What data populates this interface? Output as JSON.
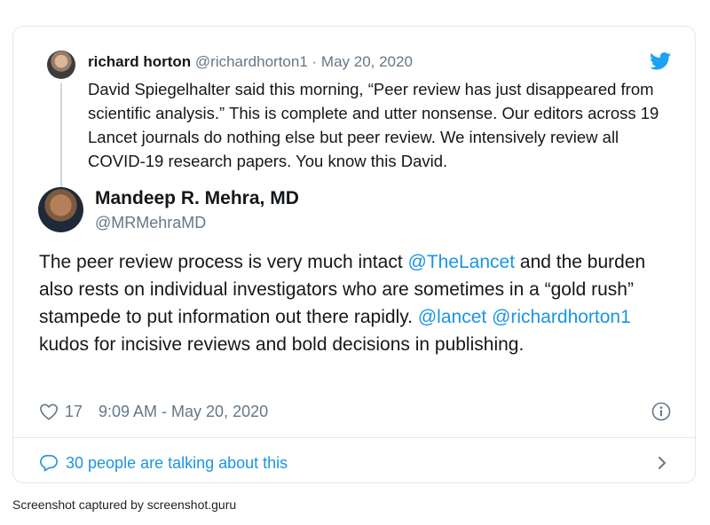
{
  "quoted_tweet": {
    "author_name": "richard horton",
    "author_handle": "@richardhorton1",
    "separator": " · ",
    "date": "May 20, 2020",
    "text": "David Spiegelhalter said this morning, “Peer review has just disappeared from scientific analysis.” This is complete and utter nonsense. Our editors across 19 Lancet journals do nothing else but peer review. We intensively review all COVID-19 research papers. You know this David."
  },
  "main_tweet": {
    "author_name": "Mandeep R. Mehra, MD",
    "author_handle": "@MRMehraMD",
    "text_1": "The peer review process is very much intact ",
    "mention_1": "@TheLancet",
    "text_2": " and the burden also rests on individual investigators who are sometimes in a “gold rush” stampede to put information out there rapidly. ",
    "mention_2": "@lancet",
    "text_3": " ",
    "mention_3": "@richardhorton1",
    "text_4": " kudos for incisive reviews and bold decisions in publishing."
  },
  "footer": {
    "like_count": "17",
    "timestamp": "9:09 AM - May 20, 2020"
  },
  "talking": {
    "label": "30 people are talking about this"
  },
  "caption": "Screenshot captured by screenshot.guru",
  "colors": {
    "link": "#1b95e0",
    "muted": "#657786",
    "text": "#14171a",
    "border": "#e1e8ed"
  },
  "icons": [
    "twitter-bird-icon",
    "heart-icon",
    "info-icon",
    "speech-bubble-icon",
    "chevron-right-icon"
  ]
}
